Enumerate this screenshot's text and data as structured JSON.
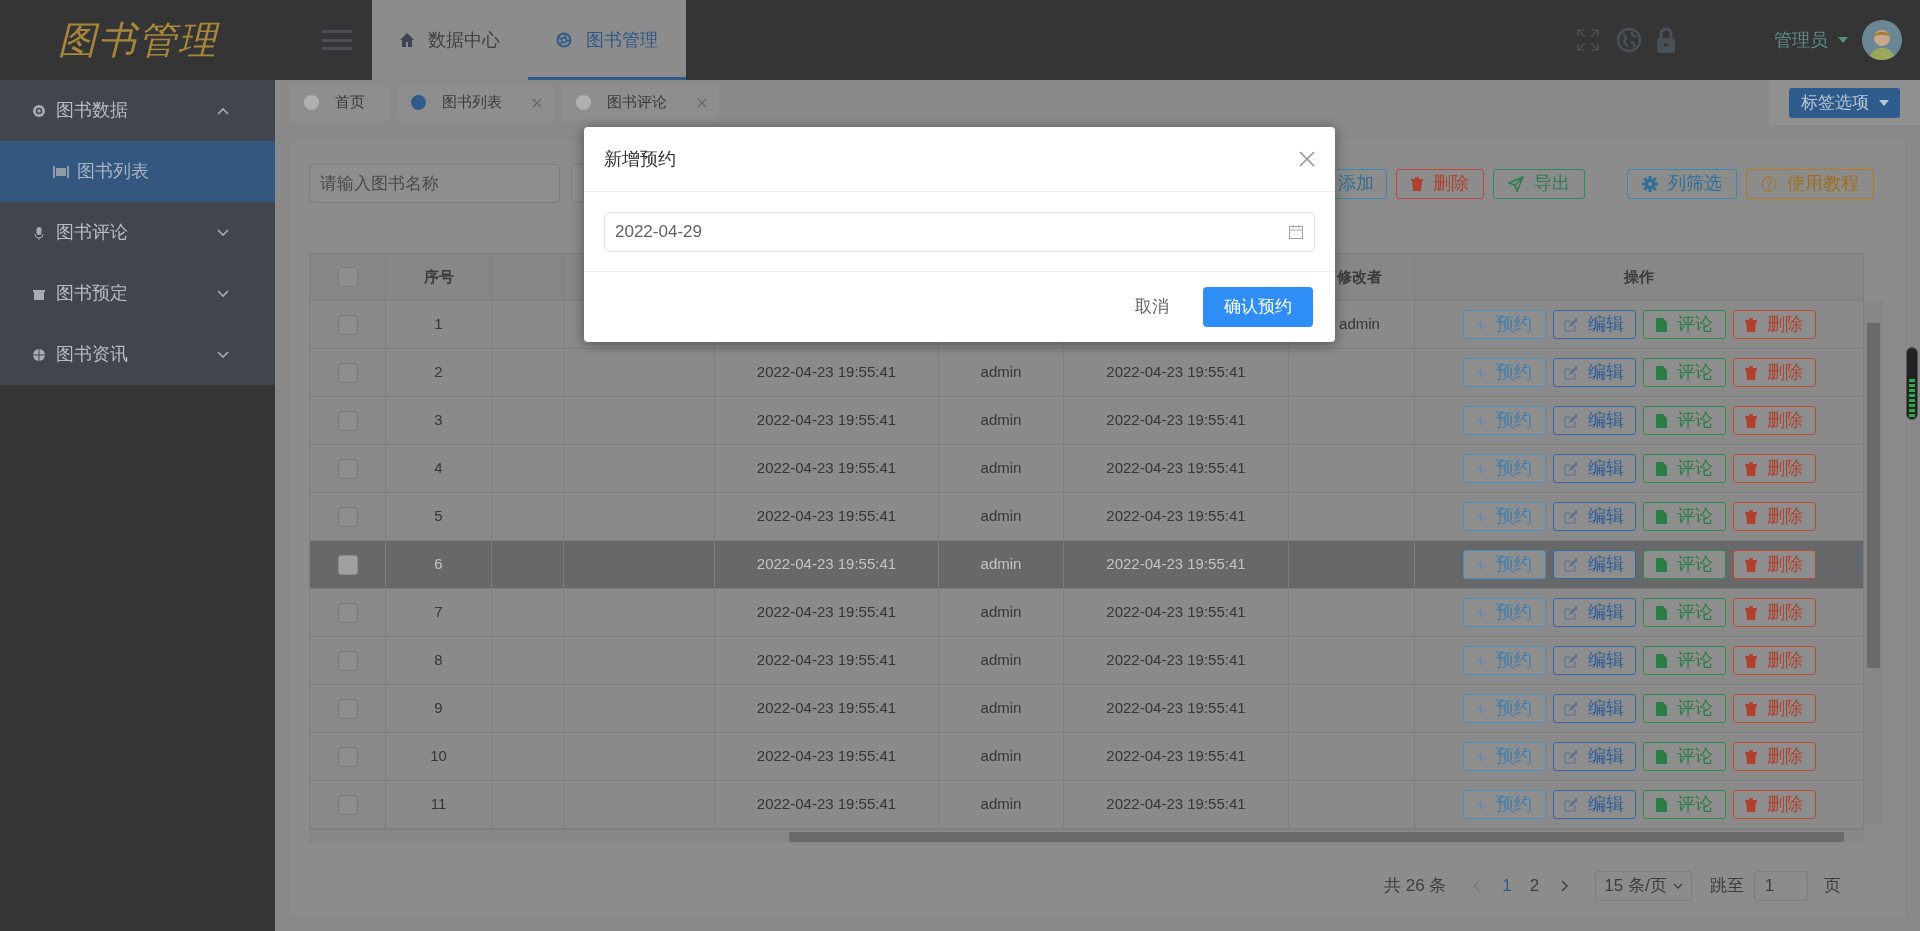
{
  "logo": "图书管理",
  "top_nav": [
    {
      "label": "数据中心",
      "selected": false
    },
    {
      "label": "图书管理",
      "selected": true
    }
  ],
  "user": {
    "name": "管理员"
  },
  "sidebar": {
    "items": [
      {
        "label": "图书数据",
        "expanded": true,
        "children": [
          {
            "label": "图书列表",
            "selected": true
          }
        ]
      },
      {
        "label": "图书评论",
        "expanded": false
      },
      {
        "label": "图书预定",
        "expanded": false
      },
      {
        "label": "图书资讯",
        "expanded": false
      }
    ]
  },
  "page_tabs": [
    {
      "label": "首页",
      "selected": false,
      "closable": false
    },
    {
      "label": "图书列表",
      "selected": true,
      "closable": true
    },
    {
      "label": "图书评论",
      "selected": false,
      "closable": true
    }
  ],
  "tab_options_button": "标签选项",
  "search": {
    "placeholder": "请输入图书名称"
  },
  "toolbar": [
    {
      "kind": "add",
      "label": "添加"
    },
    {
      "kind": "delete",
      "label": "删除"
    },
    {
      "kind": "export",
      "label": "导出"
    },
    {
      "kind": "columns",
      "label": "列筛选"
    },
    {
      "kind": "help",
      "label": "使用教程"
    }
  ],
  "table": {
    "columns": [
      {
        "kind": "checkbox",
        "checked": false
      },
      {
        "kind": "text",
        "label": "序号"
      },
      {
        "kind": "blank"
      },
      {
        "kind": "blank"
      },
      {
        "kind": "blank"
      },
      {
        "kind": "blank"
      },
      {
        "kind": "blank"
      },
      {
        "kind": "text",
        "label": "修改者"
      },
      {
        "kind": "text",
        "label": "操作"
      }
    ],
    "rows": [
      {
        "checked": false,
        "selected": false,
        "number": "1",
        "modifier": "admin",
        "actions": [
          {
            "kind": "reserve",
            "label": "预约"
          },
          {
            "kind": "edit",
            "label": "编辑"
          },
          {
            "kind": "comment",
            "label": "评论"
          },
          {
            "kind": "delete",
            "label": "删除"
          }
        ]
      },
      {
        "checked": false,
        "selected": false,
        "number": "2",
        "column_5": "2022-04-23 19:55:41",
        "column_6": "admin",
        "column_7": "2022-04-23 19:55:41",
        "actions": [
          {
            "kind": "reserve",
            "label": "预约"
          },
          {
            "kind": "edit",
            "label": "编辑"
          },
          {
            "kind": "comment",
            "label": "评论"
          },
          {
            "kind": "delete",
            "label": "删除"
          }
        ]
      },
      {
        "checked": false,
        "selected": false,
        "number": "3",
        "column_5": "2022-04-23 19:55:41",
        "column_6": "admin",
        "column_7": "2022-04-23 19:55:41",
        "actions": [
          {
            "kind": "reserve",
            "label": "预约"
          },
          {
            "kind": "edit",
            "label": "编辑"
          },
          {
            "kind": "comment",
            "label": "评论"
          },
          {
            "kind": "delete",
            "label": "删除"
          }
        ]
      },
      {
        "checked": false,
        "selected": false,
        "number": "4",
        "column_5": "2022-04-23 19:55:41",
        "column_6": "admin",
        "column_7": "2022-04-23 19:55:41",
        "actions": [
          {
            "kind": "reserve",
            "label": "预约"
          },
          {
            "kind": "edit",
            "label": "编辑"
          },
          {
            "kind": "comment",
            "label": "评论"
          },
          {
            "kind": "delete",
            "label": "删除"
          }
        ]
      },
      {
        "checked": false,
        "selected": false,
        "number": "5",
        "column_5": "2022-04-23 19:55:41",
        "column_6": "admin",
        "column_7": "2022-04-23 19:55:41",
        "actions": [
          {
            "kind": "reserve",
            "label": "预约"
          },
          {
            "kind": "edit",
            "label": "编辑"
          },
          {
            "kind": "comment",
            "label": "评论"
          },
          {
            "kind": "delete",
            "label": "删除"
          }
        ]
      },
      {
        "checked": false,
        "selected": true,
        "number": "6",
        "column_5": "2022-04-23 19:55:41",
        "column_6": "admin",
        "column_7": "2022-04-23 19:55:41",
        "actions": [
          {
            "kind": "reserve",
            "label": "预约"
          },
          {
            "kind": "edit",
            "label": "编辑"
          },
          {
            "kind": "comment",
            "label": "评论"
          },
          {
            "kind": "delete",
            "label": "删除"
          }
        ]
      },
      {
        "checked": false,
        "selected": false,
        "number": "7",
        "column_5": "2022-04-23 19:55:41",
        "column_6": "admin",
        "column_7": "2022-04-23 19:55:41",
        "actions": [
          {
            "kind": "reserve",
            "label": "预约"
          },
          {
            "kind": "edit",
            "label": "编辑"
          },
          {
            "kind": "comment",
            "label": "评论"
          },
          {
            "kind": "delete",
            "label": "删除"
          }
        ]
      },
      {
        "checked": false,
        "selected": false,
        "number": "8",
        "column_5": "2022-04-23 19:55:41",
        "column_6": "admin",
        "column_7": "2022-04-23 19:55:41",
        "actions": [
          {
            "kind": "reserve",
            "label": "预约"
          },
          {
            "kind": "edit",
            "label": "编辑"
          },
          {
            "kind": "comment",
            "label": "评论"
          },
          {
            "kind": "delete",
            "label": "删除"
          }
        ]
      },
      {
        "checked": false,
        "selected": false,
        "number": "9",
        "column_5": "2022-04-23 19:55:41",
        "column_6": "admin",
        "column_7": "2022-04-23 19:55:41",
        "actions": [
          {
            "kind": "reserve",
            "label": "预约"
          },
          {
            "kind": "edit",
            "label": "编辑"
          },
          {
            "kind": "comment",
            "label": "评论"
          },
          {
            "kind": "delete",
            "label": "删除"
          }
        ]
      },
      {
        "checked": false,
        "selected": false,
        "number": "10",
        "column_5": "2022-04-23 19:55:41",
        "column_6": "admin",
        "column_7": "2022-04-23 19:55:41",
        "actions": [
          {
            "kind": "reserve",
            "label": "预约"
          },
          {
            "kind": "edit",
            "label": "编辑"
          },
          {
            "kind": "comment",
            "label": "评论"
          },
          {
            "kind": "delete",
            "label": "删除"
          }
        ]
      },
      {
        "checked": false,
        "selected": false,
        "number": "11",
        "column_5": "2022-04-23 19:55:41",
        "column_6": "admin",
        "column_7": "2022-04-23 19:55:41",
        "actions": [
          {
            "kind": "reserve",
            "label": "预约"
          },
          {
            "kind": "edit",
            "label": "编辑"
          },
          {
            "kind": "comment",
            "label": "评论"
          },
          {
            "kind": "delete",
            "label": "删除"
          }
        ]
      }
    ]
  },
  "pagination": {
    "total": "共 26 条",
    "pages": [
      {
        "label": "1",
        "selected": true
      },
      {
        "label": "2",
        "selected": false
      }
    ],
    "page_size": "15 条/页",
    "jump_label": "跳至",
    "jump_value": "1",
    "page_suffix": "页"
  },
  "dialog": {
    "title": "新增预约",
    "date_value": "2022-04-29",
    "cancel": "取消",
    "confirm": "确认预约"
  }
}
